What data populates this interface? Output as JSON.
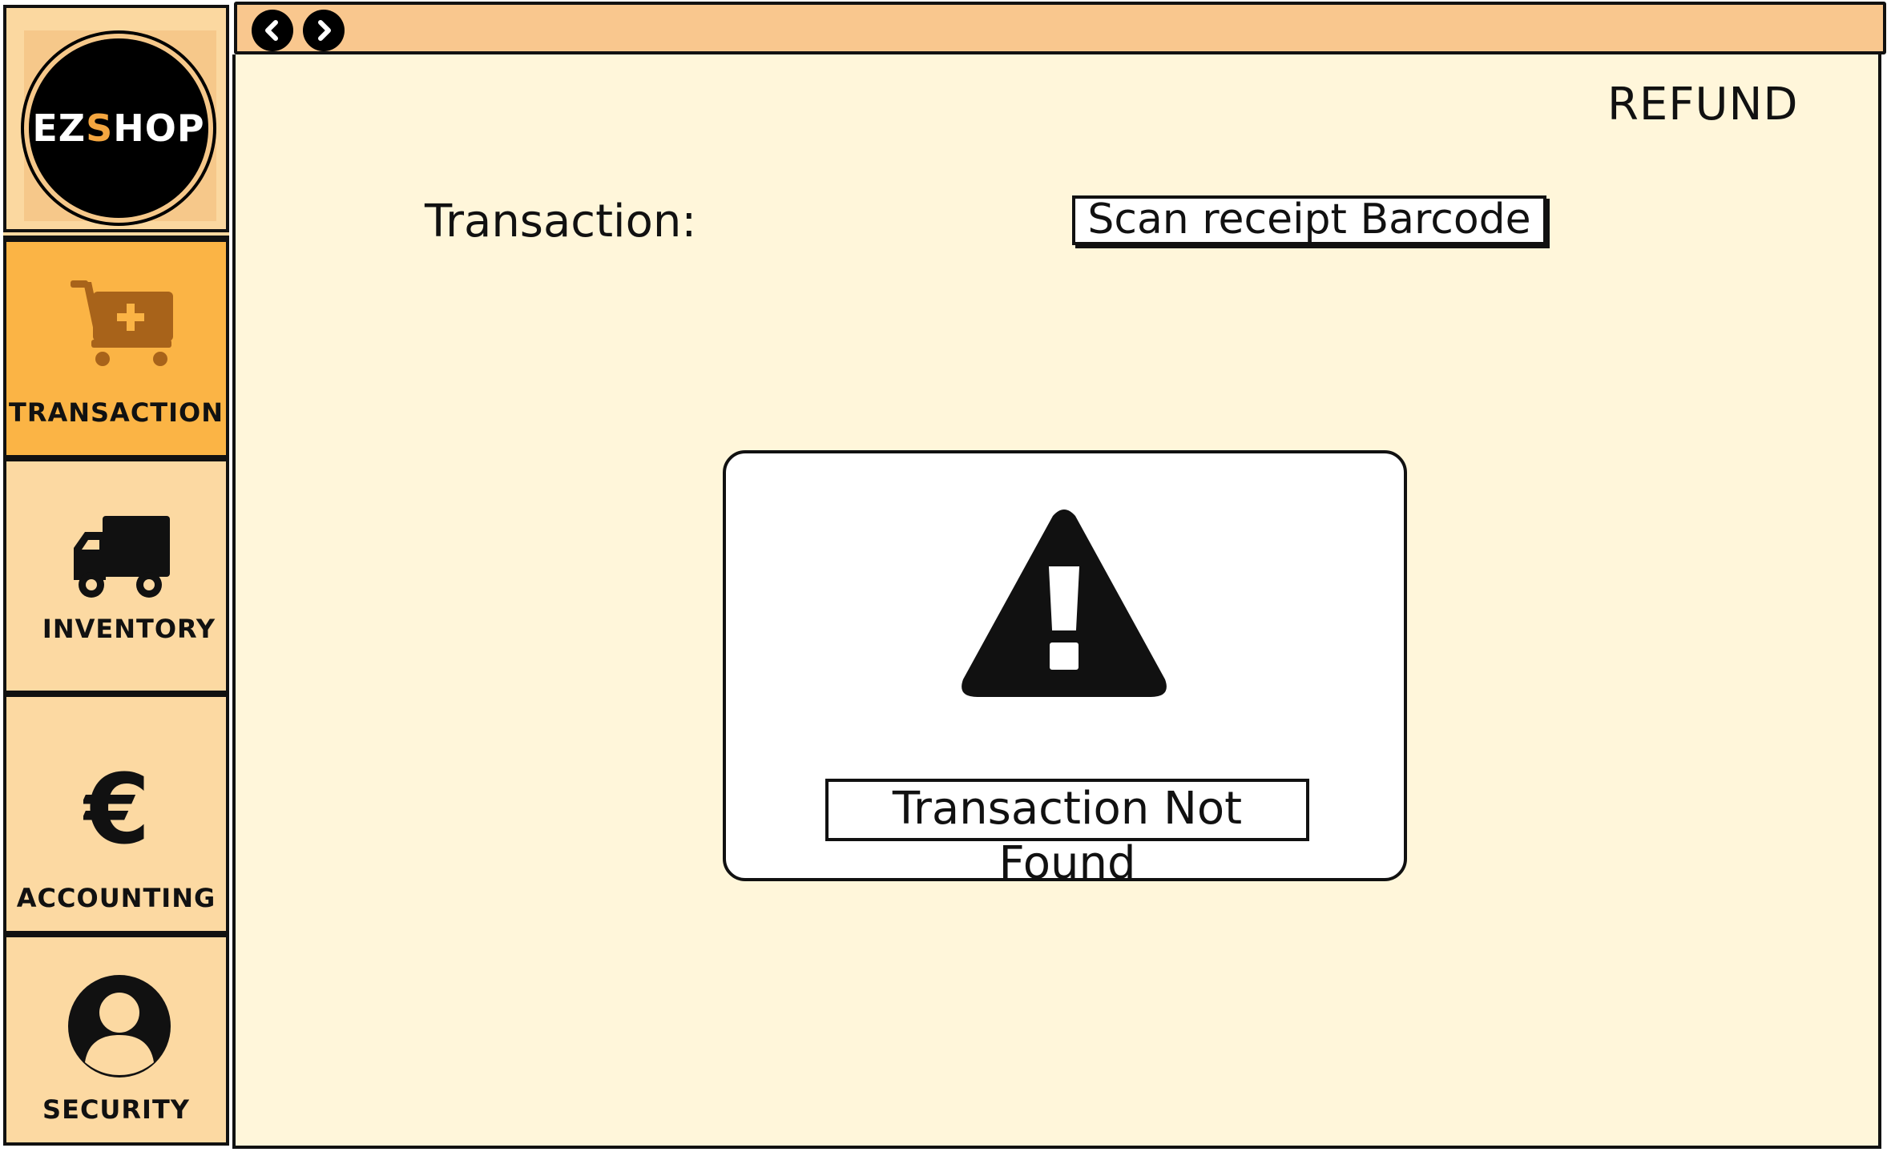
{
  "logo": {
    "text_main_1": "EZ",
    "text_accent": "S",
    "text_main_2": "HOP"
  },
  "sidebar": {
    "items": [
      {
        "label": "TRANSACTION",
        "icon": "cart-plus-icon",
        "active": true
      },
      {
        "label": "INVENTORY",
        "icon": "truck-icon",
        "active": false
      },
      {
        "label": "ACCOUNTING",
        "icon": "euro-icon",
        "active": false
      },
      {
        "label": "SECURITY",
        "icon": "user-icon",
        "active": false
      }
    ]
  },
  "titlebar": {
    "back_icon": "chevron-left-icon",
    "forward_icon": "chevron-right-icon"
  },
  "page": {
    "title": "REFUND",
    "transaction_label": "Transaction:",
    "scan_button_label": "Scan receipt Barcode"
  },
  "dialog": {
    "icon": "warning-icon",
    "message": "Transaction Not Found"
  },
  "colors": {
    "sidebar_bg": "#fcd9a2",
    "active_bg": "#fbb445",
    "titlebar_bg": "#f9c78e",
    "content_bg": "#fff6da",
    "logo_accent": "#f4a640"
  }
}
